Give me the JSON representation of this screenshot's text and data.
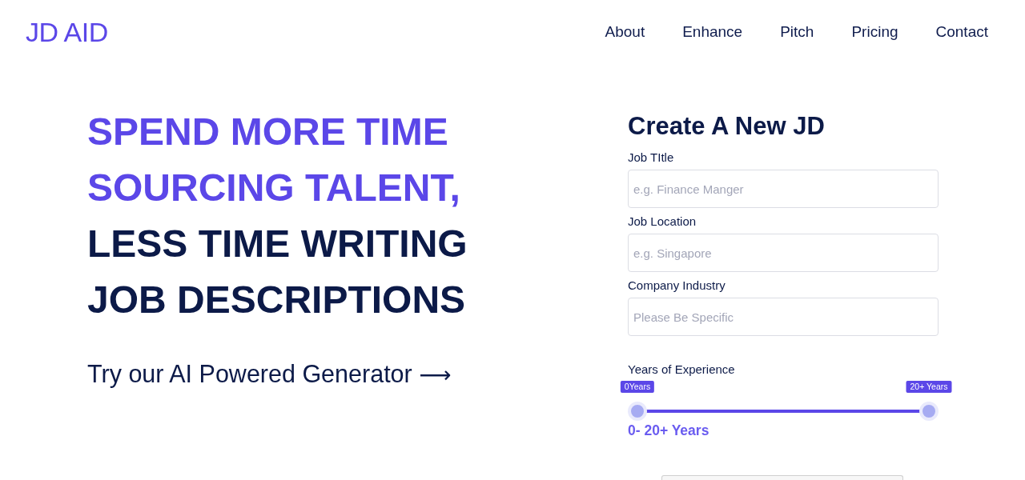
{
  "header": {
    "logo": "JD AID",
    "nav": [
      "About",
      "Enhance",
      "Pitch",
      "Pricing",
      "Contact"
    ]
  },
  "hero": {
    "headline": [
      {
        "text": "SPEND MORE TIME",
        "accent": true
      },
      {
        "text": "SOURCING TALENT,",
        "accent": true
      },
      {
        "text": "LESS TIME WRITING",
        "accent": false
      },
      {
        "text": "JOB DESCRIPTIONS",
        "accent": false
      }
    ],
    "cta": {
      "label": "Try our AI Powered Generator",
      "arrow": "⟶"
    }
  },
  "form": {
    "title": "Create A New JD",
    "fields": [
      {
        "label": "Job TItle",
        "placeholder": "e.g. Finance Manger"
      },
      {
        "label": "Job Location",
        "placeholder": "e.g. Singapore"
      },
      {
        "label": "Company Industry",
        "placeholder": "Please Be Specific"
      }
    ],
    "experience": {
      "label": "Years of Experience",
      "thumbs": [
        {
          "tooltip": "0Years",
          "level": 0
        },
        {
          "tooltip": "20+ Years",
          "level": 1
        }
      ],
      "summary": "0- 20+ Years"
    }
  }
}
